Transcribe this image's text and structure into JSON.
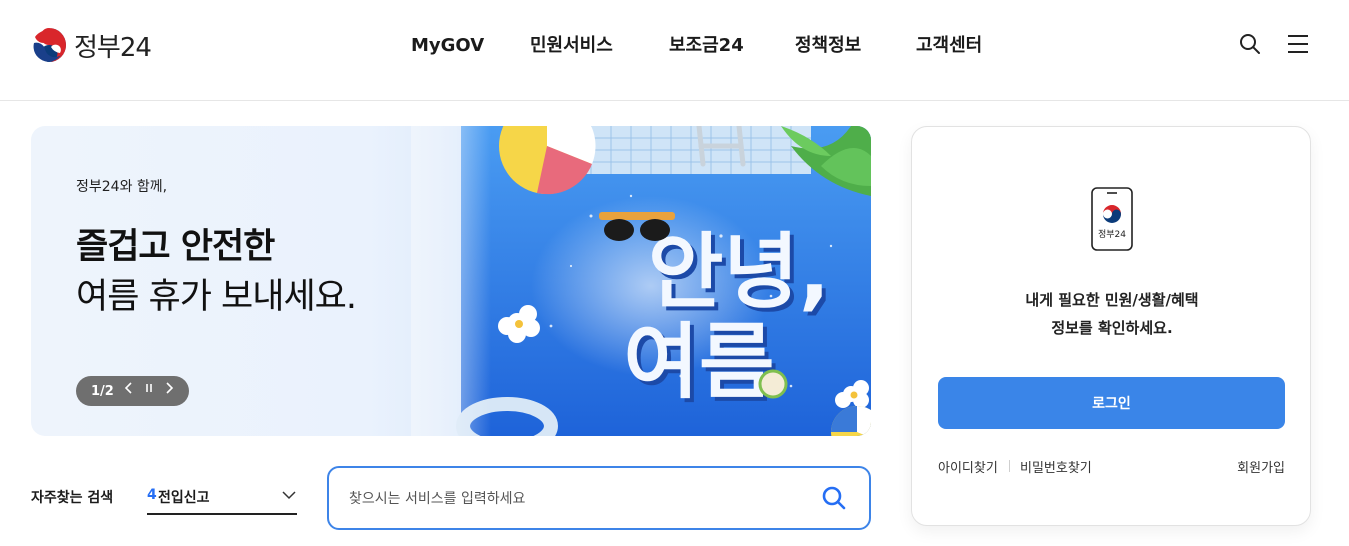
{
  "header": {
    "logo_text": "정부24",
    "nav": [
      "MyGOV",
      "민원서비스",
      "보조금24",
      "정책정보",
      "고객센터"
    ],
    "search_icon": "search-icon",
    "menu_icon": "hamburger-menu-icon"
  },
  "banner": {
    "subtitle": "정부24와 함께,",
    "title_line1": "즐겁고 안전한",
    "title_line2": "여름 휴가 보내세요.",
    "art_text_line1": "안녕,",
    "art_text_line2": "여름",
    "pager": "1/2"
  },
  "search": {
    "favorite_label": "자주찾는 검색",
    "favorite_rank": "4",
    "favorite_value": "전입신고",
    "placeholder": "찾으시는 서비스를 입력하세요"
  },
  "login": {
    "app_label": "정부24",
    "message_line1": "내게 필요한 민원/생활/혜택",
    "message_line2": "정보를 확인하세요.",
    "button": "로그인",
    "find_id": "아이디찾기",
    "find_pw": "비밀번호찾기",
    "signup": "회원가입"
  },
  "colors": {
    "accent": "#3a85e8",
    "search_border": "#3d84e8",
    "rank_blue": "#256ef4",
    "pager_bg": "#6f6f6f"
  }
}
